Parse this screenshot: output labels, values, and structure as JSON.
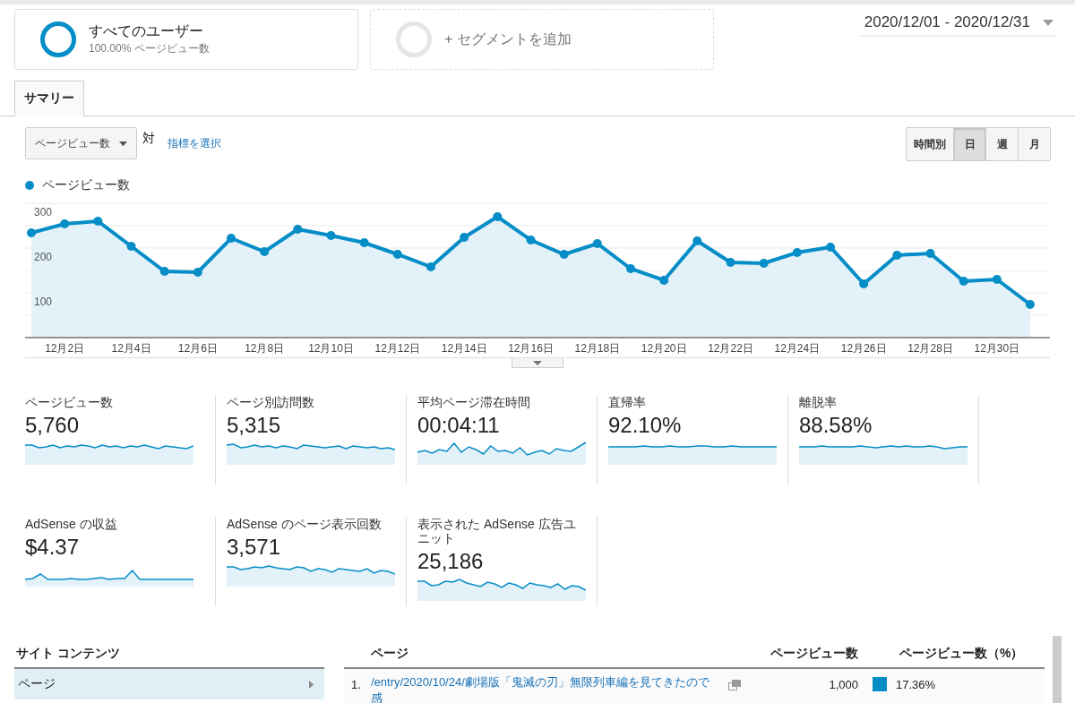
{
  "segments": [
    {
      "kind": "active",
      "title": "すべてのユーザー",
      "subtitle": "100.00% ページビュー数"
    },
    {
      "kind": "add",
      "title": "+ セグメントを追加"
    }
  ],
  "date_range": "2020/12/01 - 2020/12/31",
  "tabs": [
    {
      "label": "サマリー",
      "selected": true
    }
  ],
  "metric_select": {
    "value": "ページビュー数",
    "versus": "対",
    "link": "指標を選択"
  },
  "granularity": [
    {
      "label": "時間別",
      "selected": false
    },
    {
      "label": "日",
      "selected": true
    },
    {
      "label": "週",
      "selected": false
    },
    {
      "label": "月",
      "selected": false
    }
  ],
  "chart": {
    "chart_data": {
      "type": "area",
      "categories": [
        null,
        "12月2日",
        null,
        "12月4日",
        null,
        "12月6日",
        null,
        "12月8日",
        null,
        "12月10日",
        null,
        "12月12日",
        null,
        "12月14日",
        null,
        "12月16日",
        null,
        "12月18日",
        null,
        "12月20日",
        null,
        "12月22日",
        null,
        "12月24日",
        null,
        "12月26日",
        null,
        "12月28日",
        null,
        "12月30日",
        null
      ],
      "series": [
        {
          "name": "ページビュー数",
          "color": "#058dc7",
          "values": [
            234,
            254,
            260,
            204,
            148,
            146,
            222,
            192,
            242,
            228,
            212,
            186,
            158,
            224,
            270,
            218,
            186,
            210,
            154,
            128,
            216,
            168,
            166,
            190,
            202,
            120,
            184,
            188,
            126,
            130,
            74
          ]
        }
      ],
      "ylim": [
        0,
        300
      ],
      "yticks": [
        100,
        200,
        300
      ]
    }
  },
  "metric_rows": [
    [
      {
        "label": "ページビュー数",
        "value": "5,760"
      },
      {
        "label": "ページ別訪問数",
        "value": "5,315"
      },
      {
        "label": "平均ページ滞在時間",
        "value": "00:04:11"
      },
      {
        "label": "直帰率",
        "value": "92.10%"
      },
      {
        "label": "離脱率",
        "value": "88.58%"
      }
    ],
    [
      {
        "label": "AdSense の収益",
        "value": "$4.37"
      },
      {
        "label": "AdSense のページ表示回数",
        "value": "3,571"
      },
      {
        "label": "表示された AdSense 広告ユニット",
        "value": "25,186"
      }
    ]
  ],
  "site_content": {
    "title": "サイト コンテンツ",
    "items": [
      {
        "label": "ページ",
        "selected": true
      }
    ]
  },
  "table": {
    "columns": [
      "ページ",
      "ページビュー数",
      "ページビュー数（%）"
    ],
    "rows": [
      {
        "index": "1.",
        "page": "/entry/2020/10/24/劇場版「鬼滅の刃」無限列車編を見てきたので感",
        "pageviews": "1,000",
        "share": "17.36%"
      }
    ]
  }
}
